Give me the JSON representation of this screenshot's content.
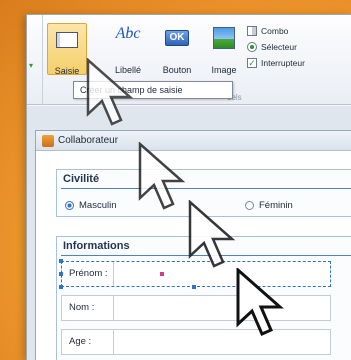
{
  "ribbon": {
    "buttons": [
      {
        "id": "saisie",
        "label": "Saisie"
      },
      {
        "id": "libelle",
        "label": "Libellé",
        "glyph": "Abc"
      },
      {
        "id": "bouton",
        "label": "Bouton",
        "glyph": "OK"
      },
      {
        "id": "image",
        "label": "Image"
      }
    ],
    "side_items": [
      {
        "label": "Combo",
        "icon": "combo-icon"
      },
      {
        "label": "Sélecteur",
        "icon": "radio-icon"
      },
      {
        "label": "Interrupteur",
        "icon": "checkbox-icon"
      }
    ],
    "group_label": "uels"
  },
  "tooltip": "Créer un champ de saisie",
  "form": {
    "title": "Collaborateur",
    "sections": [
      {
        "title": "Civilité",
        "options": [
          {
            "label": "Masculin",
            "selected": true
          },
          {
            "label": "Féminin",
            "selected": false
          }
        ]
      },
      {
        "title": "Informations",
        "fields": [
          {
            "label": "Prénom :",
            "selected": true
          },
          {
            "label": "Nom :",
            "selected": false
          },
          {
            "label": "Age :",
            "selected": false
          }
        ]
      }
    ]
  },
  "colors": {
    "accent": "#2f74c8",
    "highlight": "#f5cf6a",
    "background": "#f6b52c"
  }
}
